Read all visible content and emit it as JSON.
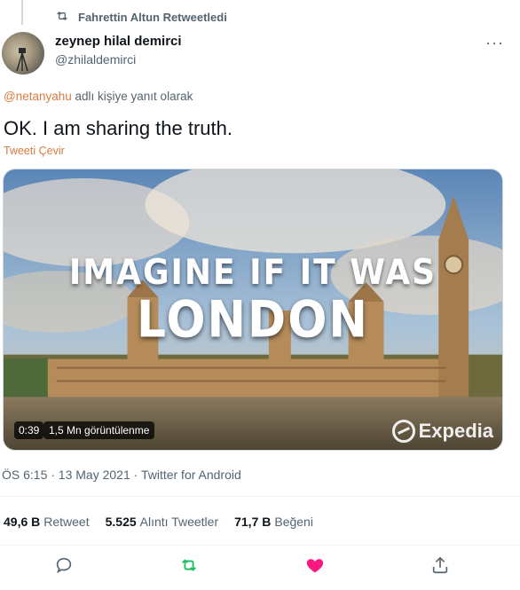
{
  "retweet": {
    "label": "Fahrettin Altun Retweetledi",
    "icon": "retweet-icon"
  },
  "author": {
    "display_name": "zeynep hilal demirci",
    "handle": "@zhilaldemirci"
  },
  "more": {
    "label": "···"
  },
  "reply": {
    "mention": "@netanyahu",
    "suffix": " adlı kişiye yanıt olarak"
  },
  "tweet": {
    "text": "OK. I am sharing the truth.",
    "translate_label": "Tweeti Çevir"
  },
  "media": {
    "overlay_line1": "IMAGINE IF IT WAS",
    "overlay_line2": "LONDON",
    "duration": "0:39",
    "views": "1,5 Mn görüntülenme",
    "watermark": "Expedia"
  },
  "meta": {
    "time": "ÖS 6:15",
    "date": "13 May 2021",
    "source": "Twitter for Android",
    "text": "ÖS 6:15 · 13 May 2021 · Twitter for Android"
  },
  "stats": {
    "retweets_count": "49,6 B",
    "retweets_label": "Retweet",
    "quotes_count": "5.525",
    "quotes_label": "Alıntı Tweetler",
    "likes_count": "71,7 B",
    "likes_label": "Beğeni"
  },
  "colors": {
    "accent_link": "#d97b3f",
    "retweet_green": "#17bf63",
    "like_pink": "#f91880",
    "muted": "#536471"
  },
  "actions": {
    "icons": [
      "reply-icon",
      "retweet-icon",
      "like-icon",
      "share-icon"
    ]
  }
}
